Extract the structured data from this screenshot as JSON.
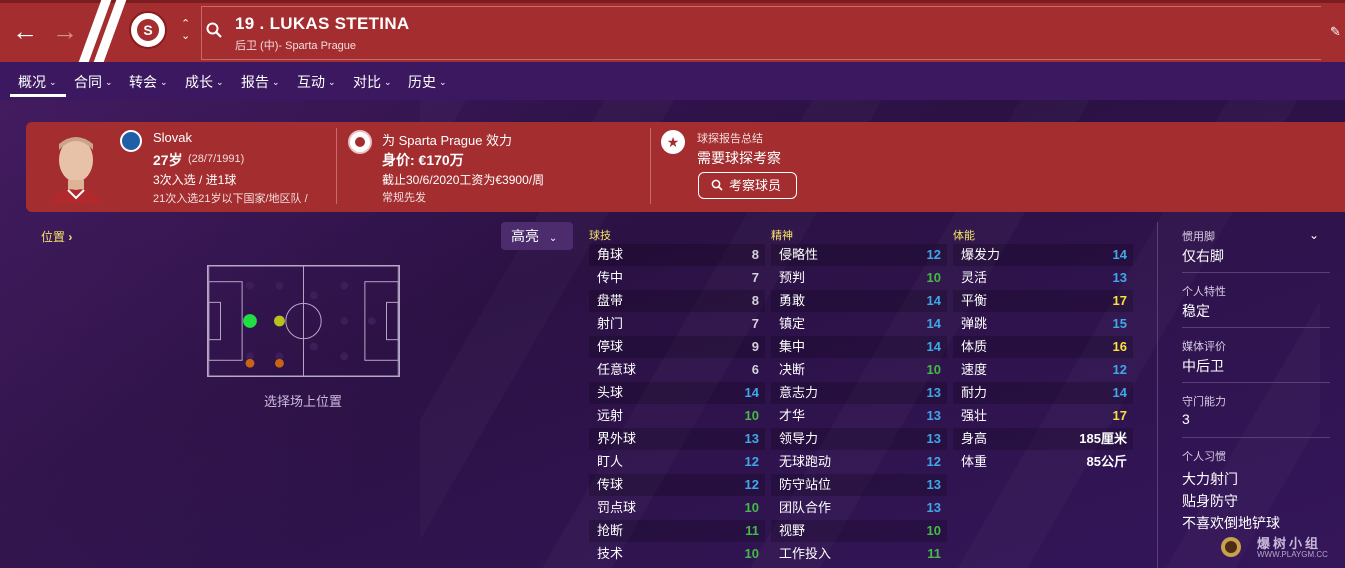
{
  "header": {
    "title": "19 . LUKAS STETINA",
    "subtitle": "后卫 (中)- Sparta Prague"
  },
  "tabs": [
    {
      "label": "概况"
    },
    {
      "label": "合同"
    },
    {
      "label": "转会"
    },
    {
      "label": "成长"
    },
    {
      "label": "报告"
    },
    {
      "label": "互动"
    },
    {
      "label": "对比"
    },
    {
      "label": "历史"
    }
  ],
  "card": {
    "nationality": "Slovak",
    "age": "27岁",
    "dob": "(28/7/1991)",
    "caps": "3次入选 / 进1球",
    "youth_caps": "21次入选21岁以下国家/地区队 /",
    "club_line": "为 Sparta Prague 效力",
    "value_label": "身价: €170万",
    "contract": "截止30/6/2020工资为€3900/周",
    "role": "常规先发",
    "scout_title": "球探报告总结",
    "scout_status": "需要球探考察",
    "scout_button": "考察球员"
  },
  "position": {
    "title": "位置",
    "highlight": "高亮",
    "caption": "选择场上位置"
  },
  "technical": {
    "header": "球技",
    "rows": [
      {
        "name": "角球",
        "value": "8",
        "tone": "white"
      },
      {
        "name": "传中",
        "value": "7",
        "tone": "white"
      },
      {
        "name": "盘带",
        "value": "8",
        "tone": "white"
      },
      {
        "name": "射门",
        "value": "7",
        "tone": "white"
      },
      {
        "name": "停球",
        "value": "9",
        "tone": "white"
      },
      {
        "name": "任意球",
        "value": "6",
        "tone": "white"
      },
      {
        "name": "头球",
        "value": "14",
        "tone": "blue"
      },
      {
        "name": "远射",
        "value": "10",
        "tone": "green"
      },
      {
        "name": "界外球",
        "value": "13",
        "tone": "blue"
      },
      {
        "name": "盯人",
        "value": "12",
        "tone": "blue"
      },
      {
        "name": "传球",
        "value": "12",
        "tone": "blue"
      },
      {
        "name": "罚点球",
        "value": "10",
        "tone": "green"
      },
      {
        "name": "抢断",
        "value": "11",
        "tone": "green"
      },
      {
        "name": "技术",
        "value": "10",
        "tone": "green"
      }
    ]
  },
  "mental": {
    "header": "精神",
    "rows": [
      {
        "name": "侵略性",
        "value": "12",
        "tone": "blue"
      },
      {
        "name": "预判",
        "value": "10",
        "tone": "green"
      },
      {
        "name": "勇敢",
        "value": "14",
        "tone": "blue"
      },
      {
        "name": "镇定",
        "value": "14",
        "tone": "blue"
      },
      {
        "name": "集中",
        "value": "14",
        "tone": "blue"
      },
      {
        "name": "决断",
        "value": "10",
        "tone": "green"
      },
      {
        "name": "意志力",
        "value": "13",
        "tone": "blue"
      },
      {
        "name": "才华",
        "value": "13",
        "tone": "blue"
      },
      {
        "name": "领导力",
        "value": "13",
        "tone": "blue"
      },
      {
        "name": "无球跑动",
        "value": "12",
        "tone": "blue"
      },
      {
        "name": "防守站位",
        "value": "13",
        "tone": "blue"
      },
      {
        "name": "团队合作",
        "value": "13",
        "tone": "blue"
      },
      {
        "name": "视野",
        "value": "10",
        "tone": "green"
      },
      {
        "name": "工作投入",
        "value": "11",
        "tone": "green"
      }
    ]
  },
  "physical": {
    "header": "体能",
    "rows": [
      {
        "name": "爆发力",
        "value": "14",
        "tone": "blue"
      },
      {
        "name": "灵活",
        "value": "13",
        "tone": "blue"
      },
      {
        "name": "平衡",
        "value": "17",
        "tone": "yellow"
      },
      {
        "name": "弹跳",
        "value": "15",
        "tone": "blue"
      },
      {
        "name": "体质",
        "value": "16",
        "tone": "yellow"
      },
      {
        "name": "速度",
        "value": "12",
        "tone": "blue"
      },
      {
        "name": "耐力",
        "value": "14",
        "tone": "blue"
      },
      {
        "name": "强壮",
        "value": "17",
        "tone": "yellow"
      },
      {
        "name": "身高",
        "value": "185厘米",
        "tone": "body"
      },
      {
        "name": "体重",
        "value": "85公斤",
        "tone": "body"
      }
    ]
  },
  "side": {
    "foot_label": "惯用脚",
    "foot_value": "仅右脚",
    "trait_label": "个人特性",
    "trait_value": "稳定",
    "media_label": "媒体评价",
    "media_value": "中后卫",
    "gk_label": "守门能力",
    "gk_value": "3",
    "habits_label": "个人习惯",
    "habits": [
      "大力射门",
      "贴身防守",
      "不喜欢倒地铲球"
    ]
  },
  "watermark": {
    "text": "爆树小组",
    "url": "WWW.PLAYGM.CC"
  },
  "colors": {
    "header": "#a42d2f",
    "background": "#2e1348",
    "accent_yellow": "#f5e26a",
    "attr_blue": "#3ea8e8",
    "attr_green": "#44bb44",
    "attr_yellow": "#f5e23a"
  }
}
